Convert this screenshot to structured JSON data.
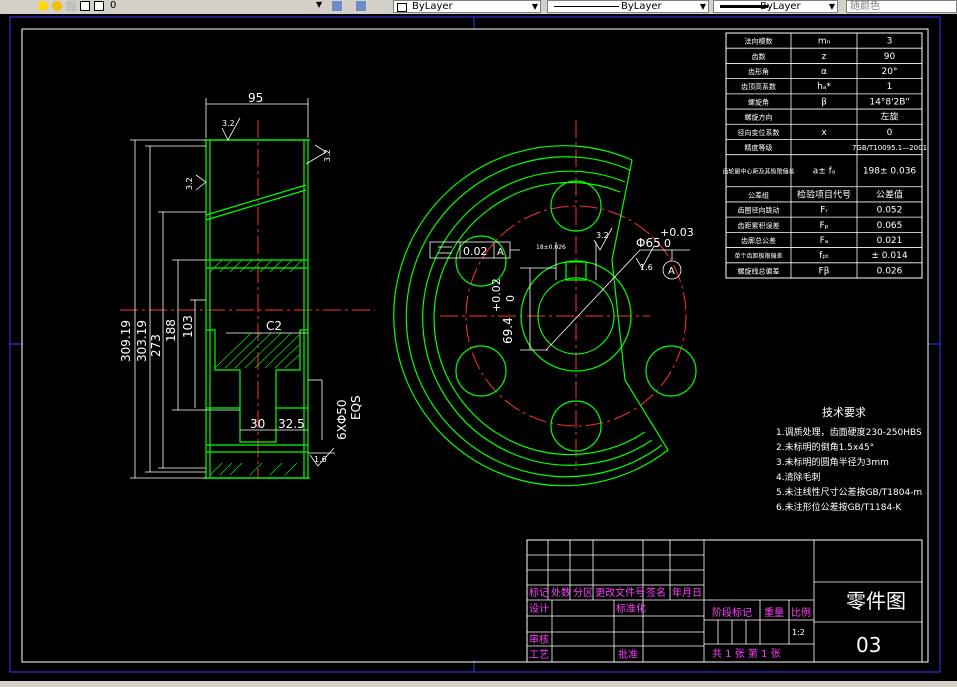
{
  "toolbar": {
    "layer_value": "0",
    "color_value": "ByLayer",
    "linetype_value": "ByLayer",
    "lineweight_value": "ByLayer",
    "plotstyle_value": "随颜色"
  },
  "dims": {
    "width_top": "95",
    "d1": "309.19",
    "d2": "303.19",
    "d3": "273",
    "d4": "188",
    "d5": "103",
    "chamfer": "C2",
    "w30": "30",
    "w32_5": "32.5",
    "holes": "6XΦ50",
    "eqs": "EQS",
    "rough1": "3.2",
    "rough2": "3.2",
    "rough3": "3.2",
    "rough4": "1.6",
    "rough5": "3.2",
    "rough6": "1.6",
    "bore": "Φ65",
    "bore_tol_up": "+0.03",
    "bore_tol_low": "0",
    "keyway": "69.4",
    "keyway_tol_up": "+0.02",
    "keyway_tol_low": "0",
    "key_width": "18±0.026",
    "flatness_value": "0.02",
    "datum": "A",
    "datum_ref": "A"
  },
  "params_table": [
    [
      "法向模数",
      "mₙ",
      "3"
    ],
    [
      "齿数",
      "z",
      "90"
    ],
    [
      "齿形角",
      "α",
      "20°"
    ],
    [
      "齿顶高系数",
      "hₐ*",
      "1"
    ],
    [
      "螺旋角",
      "β",
      "14°8'2B\""
    ],
    [
      "螺旋方向",
      "",
      "左旋"
    ],
    [
      "径向变位系数",
      "x",
      "0"
    ],
    [
      "精度等级",
      "",
      "7GB/T10095.1—2001"
    ],
    [
      "齿轮副中心距及其极限偏差",
      "a± fₐ",
      "198± 0.036"
    ],
    [
      "公差组",
      "检验项目代号",
      "公差值"
    ],
    [
      "齿圈径向跳动",
      "Fᵣ",
      "0.052"
    ],
    [
      "齿距累积误差",
      "Fₚ",
      "0.065"
    ],
    [
      "齿廓总公差",
      "Fₐ",
      "0.021"
    ],
    [
      "单个齿距极限偏差",
      "fₚₜ",
      "± 0.014"
    ],
    [
      "螺旋线总偏差",
      "Fβ",
      "0.026"
    ]
  ],
  "tech": {
    "title": "技术要求",
    "items": [
      "1.调质处理，齿面硬度230-250HBS",
      "2.未标明的倒角1.5x45°",
      "3.未标明的圆角半径为3mm",
      "4.清除毛刺",
      "5.未注线性尺寸公差按GB/T1804-m",
      "6.未注形位公差按GB/T1184-K"
    ]
  },
  "title_block": {
    "mark": "标记",
    "count": "处数",
    "zone": "分区",
    "change_doc": "更改文件号",
    "sign": "签名",
    "date": "年月日",
    "design": "设计",
    "standard": "标准化",
    "review": "审核",
    "process": "工艺",
    "approve": "批准",
    "stage_mark": "阶段标记",
    "weight": "重量",
    "scale": "比例",
    "scale_value": "1:2",
    "sheets": "共 1 张  第 1 张",
    "drawing_name": "零件图",
    "drawing_no": "03"
  }
}
